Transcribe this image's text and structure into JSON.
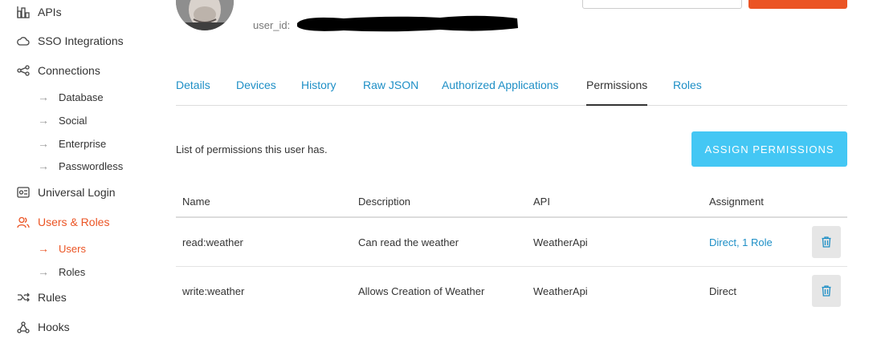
{
  "sidebar": {
    "items": [
      {
        "label": "APIs",
        "icon": "apis-icon"
      },
      {
        "label": "SSO Integrations",
        "icon": "cloud-icon"
      },
      {
        "label": "Connections",
        "icon": "connections-icon"
      },
      {
        "label": "Universal Login",
        "icon": "login-icon"
      },
      {
        "label": "Users & Roles",
        "icon": "users-icon"
      },
      {
        "label": "Rules",
        "icon": "rules-icon"
      },
      {
        "label": "Hooks",
        "icon": "hooks-icon"
      }
    ],
    "connections_sub": [
      "Database",
      "Social",
      "Enterprise",
      "Passwordless"
    ],
    "users_sub": [
      "Users",
      "Roles"
    ],
    "active_color": "#eb5424"
  },
  "header": {
    "user_id_label": "user_id:"
  },
  "tabs": [
    "Details",
    "Devices",
    "History",
    "Raw JSON",
    "Authorized Applications",
    "Permissions",
    "Roles"
  ],
  "active_tab": "Permissions",
  "permissions": {
    "description": "List of permissions this user has.",
    "assign_button": "ASSIGN PERMISSIONS",
    "columns": [
      "Name",
      "Description",
      "API",
      "Assignment"
    ],
    "rows": [
      {
        "name": "read:weather",
        "description": "Can read the weather",
        "api": "WeatherApi",
        "assignment": "Direct, 1 Role",
        "assignment_is_link": true
      },
      {
        "name": "write:weather",
        "description": "Allows Creation of Weather",
        "api": "WeatherApi",
        "assignment": "Direct",
        "assignment_is_link": false
      }
    ]
  },
  "colors": {
    "link": "#1e8fc6",
    "assign_button": "#44c7f4",
    "primary_orange": "#eb5424"
  }
}
